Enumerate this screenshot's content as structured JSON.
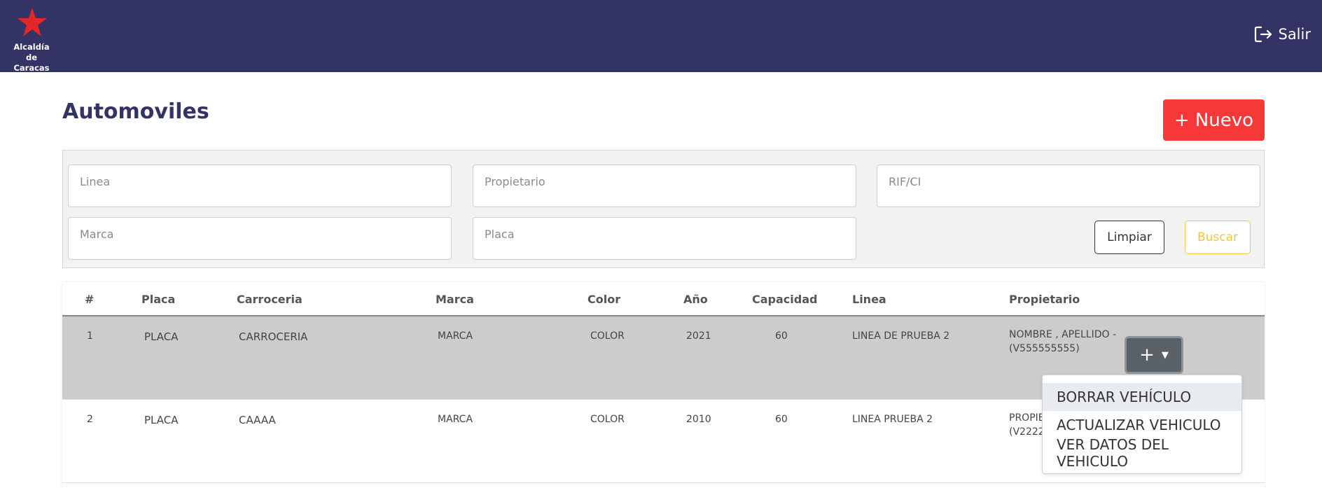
{
  "header": {
    "logo_line1": "Alcaldía",
    "logo_line2": "de Caracas",
    "logout_label": "Salir",
    "bar_color": "#333366",
    "logo_color": "#e5252a"
  },
  "page": {
    "title": "Automoviles",
    "new_button_label": "Nuevo",
    "new_button_color": "#f73838"
  },
  "filters": {
    "linea_placeholder": "Linea",
    "propietario_placeholder": "Propietario",
    "rif_placeholder": "RIF/CI",
    "marca_placeholder": "Marca",
    "placa_placeholder": "Placa",
    "clear_label": "Limpiar",
    "search_label": "Buscar"
  },
  "table": {
    "headers": [
      "#",
      "Placa",
      "Carroceria",
      "Marca",
      "Color",
      "Año",
      "Capacidad",
      "Linea",
      "Propietario"
    ],
    "rows": [
      {
        "num": "1",
        "placa": "PLACA",
        "carroceria": "CARROCERIA",
        "marca": "MARCA",
        "color": "COLOR",
        "anio": "2021",
        "capacidad": "60",
        "linea": "LINEA DE PRUEBA 2",
        "propietario": "NOMBRE , APELLIDO - (V555555555)"
      },
      {
        "num": "2",
        "placa": "PLACA",
        "carroceria": "CAAAA",
        "marca": "MARCA",
        "color": "COLOR",
        "anio": "2010",
        "capacidad": "60",
        "linea": "LINEA PRUEBA 2",
        "propietario": "PROPIE (V22222"
      }
    ]
  },
  "row_actions": {
    "button_icon": "plus-icon",
    "menu": [
      "BORRAR VEHÍCULO",
      "ACTUALIZAR VEHICULO",
      "VER DATOS DEL VEHICULO"
    ]
  }
}
